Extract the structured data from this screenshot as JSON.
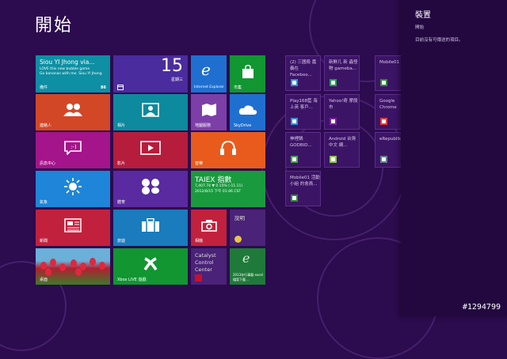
{
  "start_title": "開始",
  "tiles": {
    "people_hub": {
      "line1": "Siou YI Jhong via...",
      "line2": "LOVE this new bubble game",
      "line3": "Go bananas with me. Siou YI Jhong",
      "name": "備件",
      "badge": "86"
    },
    "calendar": {
      "day": "15",
      "weekday": "星期三"
    },
    "ie": {
      "name": "Internet Explorer"
    },
    "store": {
      "name": "市集"
    },
    "people": {
      "name": "連絡人"
    },
    "photos": {
      "name": "相片"
    },
    "maps": {
      "name": "地圖服務"
    },
    "skydrive": {
      "name": "SkyDrive"
    },
    "messaging": {
      "name": "訊息中心"
    },
    "video": {
      "name": "影片"
    },
    "music": {
      "name": "音樂"
    },
    "weather": {
      "name": "氣象"
    },
    "sports": {
      "name": "體育"
    },
    "finance": {
      "title": "TAIEX 指數",
      "line1": "7,407.74 ▼ 0.15% (-11.11)",
      "line2": "2012/8/15 下午 01:46 CST"
    },
    "news": {
      "name": "新聞"
    },
    "travel": {
      "name": "旅遊"
    },
    "camera": {
      "name": "相機"
    },
    "help": {
      "name": "說明"
    },
    "desktop": {
      "name": "桌面"
    },
    "xbox": {
      "name": "Xbox LIVE 遊戲"
    },
    "catalyst": {
      "name": "Catalyst Control Center"
    },
    "excel": {
      "name": "2013年行事曆 excel檔案下載..."
    }
  },
  "small_tiles": [
    {
      "label": "(2) 三國殺 嘉義在 Faceboo...",
      "icon_color": "#2a8fd6"
    },
    {
      "label": "新鮮几 新 蟲怪物 gameba...",
      "icon_color": "#1ea04e"
    },
    {
      "label": "Mobile01",
      "icon_color": "#2f8a3a"
    },
    {
      "label": "Play168藍 海上英 客戶...",
      "icon_color": "#2a8fd6"
    },
    {
      "label": "Yahoo!奇 摩股市",
      "icon_color": "#7b1fa2"
    },
    {
      "label": "Google Chrome",
      "icon_color": "#e53935"
    },
    {
      "label": "神裡鍋 GODBID...",
      "icon_color": "#43a047"
    },
    {
      "label": "Android 台灣中文 網...",
      "icon_color": "#8bc34a"
    },
    {
      "label": "eRepublik",
      "icon_color": "#607d8b"
    },
    {
      "label": "Mobile01 活動小組 的會員...",
      "icon_color": "#2f8a3a"
    }
  ],
  "panel": {
    "title": "裝置",
    "subtitle": "開始",
    "message": "目前沒有可傳送的項目。"
  },
  "watermark": "#1294799"
}
